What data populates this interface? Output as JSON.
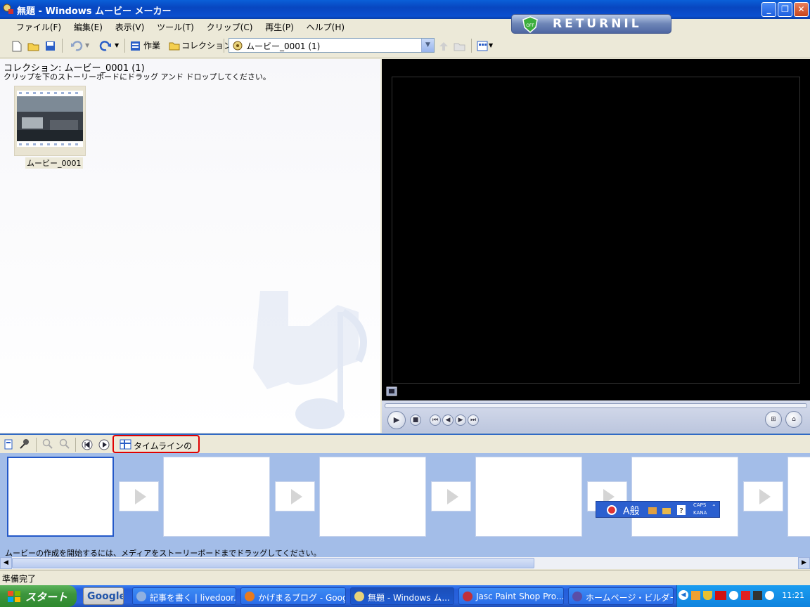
{
  "window": {
    "title": "無題 - Windows ムービー メーカー",
    "min_label": "_",
    "max_label": "❐",
    "close_label": "✕"
  },
  "returnil": {
    "label": "RETURNIL",
    "shield_label": "OFF"
  },
  "menu": [
    "ファイル(F)",
    "編集(E)",
    "表示(V)",
    "ツール(T)",
    "クリップ(C)",
    "再生(P)",
    "ヘルプ(H)"
  ],
  "toolbar": {
    "tasks_label": "作業",
    "collections_label": "コレクション",
    "collection_selected": "ムービー_0001 (1)"
  },
  "collection": {
    "heading": "コレクション: ムービー_0001 (1)",
    "instruction": "クリップを下のストーリーボードにドラッグ アンド ドロップしてください。",
    "clips": [
      {
        "label": "ムービー_0001"
      }
    ]
  },
  "storyboard": {
    "timeline_label": "タイムラインの表示",
    "hint": "ムービーの作成を開始するには、メディアをストーリーボードまでドラッグしてください。"
  },
  "langbar": {
    "text": "A般",
    "caps": "CAPS",
    "kana": "KANA"
  },
  "status": {
    "text": "準備完了"
  },
  "taskbar": {
    "start_label": "スタート",
    "google_label": "Google",
    "tasks": [
      {
        "label": "記事を書く | livedoor..."
      },
      {
        "label": "かげまるブログ - Goog..."
      },
      {
        "label": "無題 - Windows ム..."
      },
      {
        "label": "Jasc Paint Shop Pro..."
      },
      {
        "label": "ホームページ・ビルダー..."
      }
    ],
    "clock": "11:21"
  },
  "colors": {
    "accent": "#316ac5",
    "timeline_highlight": "#e00000",
    "storyboard_bg": "#a3bde8"
  }
}
